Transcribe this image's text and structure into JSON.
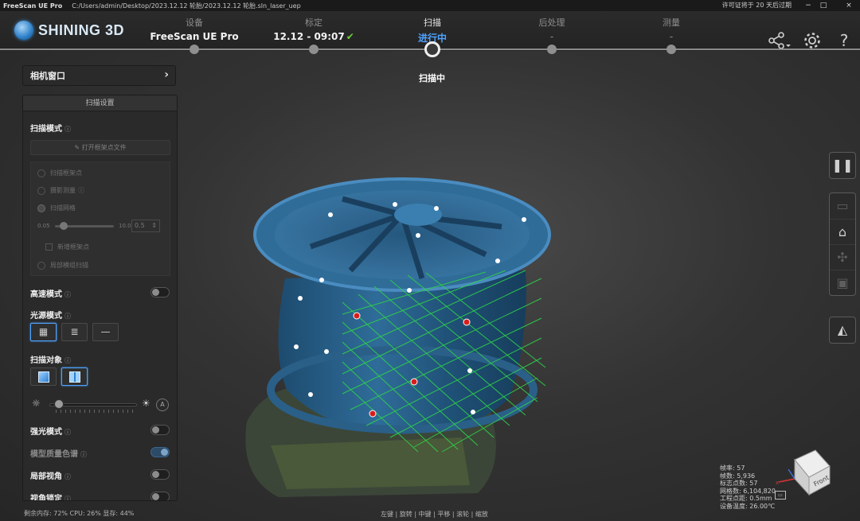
{
  "titlebar": {
    "app_name": "FreeScan UE Pro",
    "path": "C:/Users/admin/Desktop/2023.12.12 轮胎/2023.12.12 轮胎.sln_laser_uep",
    "license": "许可证将于 20 天后过期",
    "minimize": "−",
    "maximize": "□",
    "close": "×"
  },
  "header": {
    "logo_text": "SHINING 3D",
    "steps": [
      {
        "name": "设备",
        "value": "FreeScan UE Pro"
      },
      {
        "name": "标定",
        "value": "12.12 - 09:07"
      },
      {
        "name": "扫描",
        "value": "进行中"
      },
      {
        "name": "后处理",
        "value": "-"
      },
      {
        "name": "测量",
        "value": "-"
      }
    ],
    "current_status": "扫描中",
    "icons": [
      "share-icon",
      "settings-gear-icon",
      "help-icon"
    ]
  },
  "camera_window": {
    "label": "相机窗口"
  },
  "scan_settings": {
    "title": "扫描设置",
    "scan_mode_label": "扫描模式",
    "open_file_button": "打开框架点文件",
    "options": [
      "扫描框架点",
      "摄影测量",
      "扫描网格"
    ],
    "point_distance": {
      "min": "0.05",
      "max": "10.0",
      "value": "0.5"
    },
    "new_frame_points": "新增框架点",
    "local_grid_scan": "局部模组扫描",
    "high_speed_label": "高速模式",
    "light_mode_label": "光源模式",
    "scan_object_label": "扫描对象",
    "strong_light_label": "强光模式",
    "quality_color_label": "模型质量色谱",
    "local_view_label": "局部视角",
    "view_lock_label": "视角锁定",
    "brightness_auto": "A"
  },
  "statusbar": {
    "text": "剩余内存: 72%  CPU: 26%  显存: 44%",
    "hint": "左键 | 旋转 | 中键 | 平移 | 滚轮 | 缩放"
  },
  "stats": {
    "lines": [
      "帧率: 57",
      "帧数: 5,936",
      "标志点数: 57",
      "网格数: 6,104,820",
      "工程点距: 0.5mm",
      "设备温度: 26.00℃"
    ]
  },
  "viewcube": {
    "face_label": "Front"
  }
}
